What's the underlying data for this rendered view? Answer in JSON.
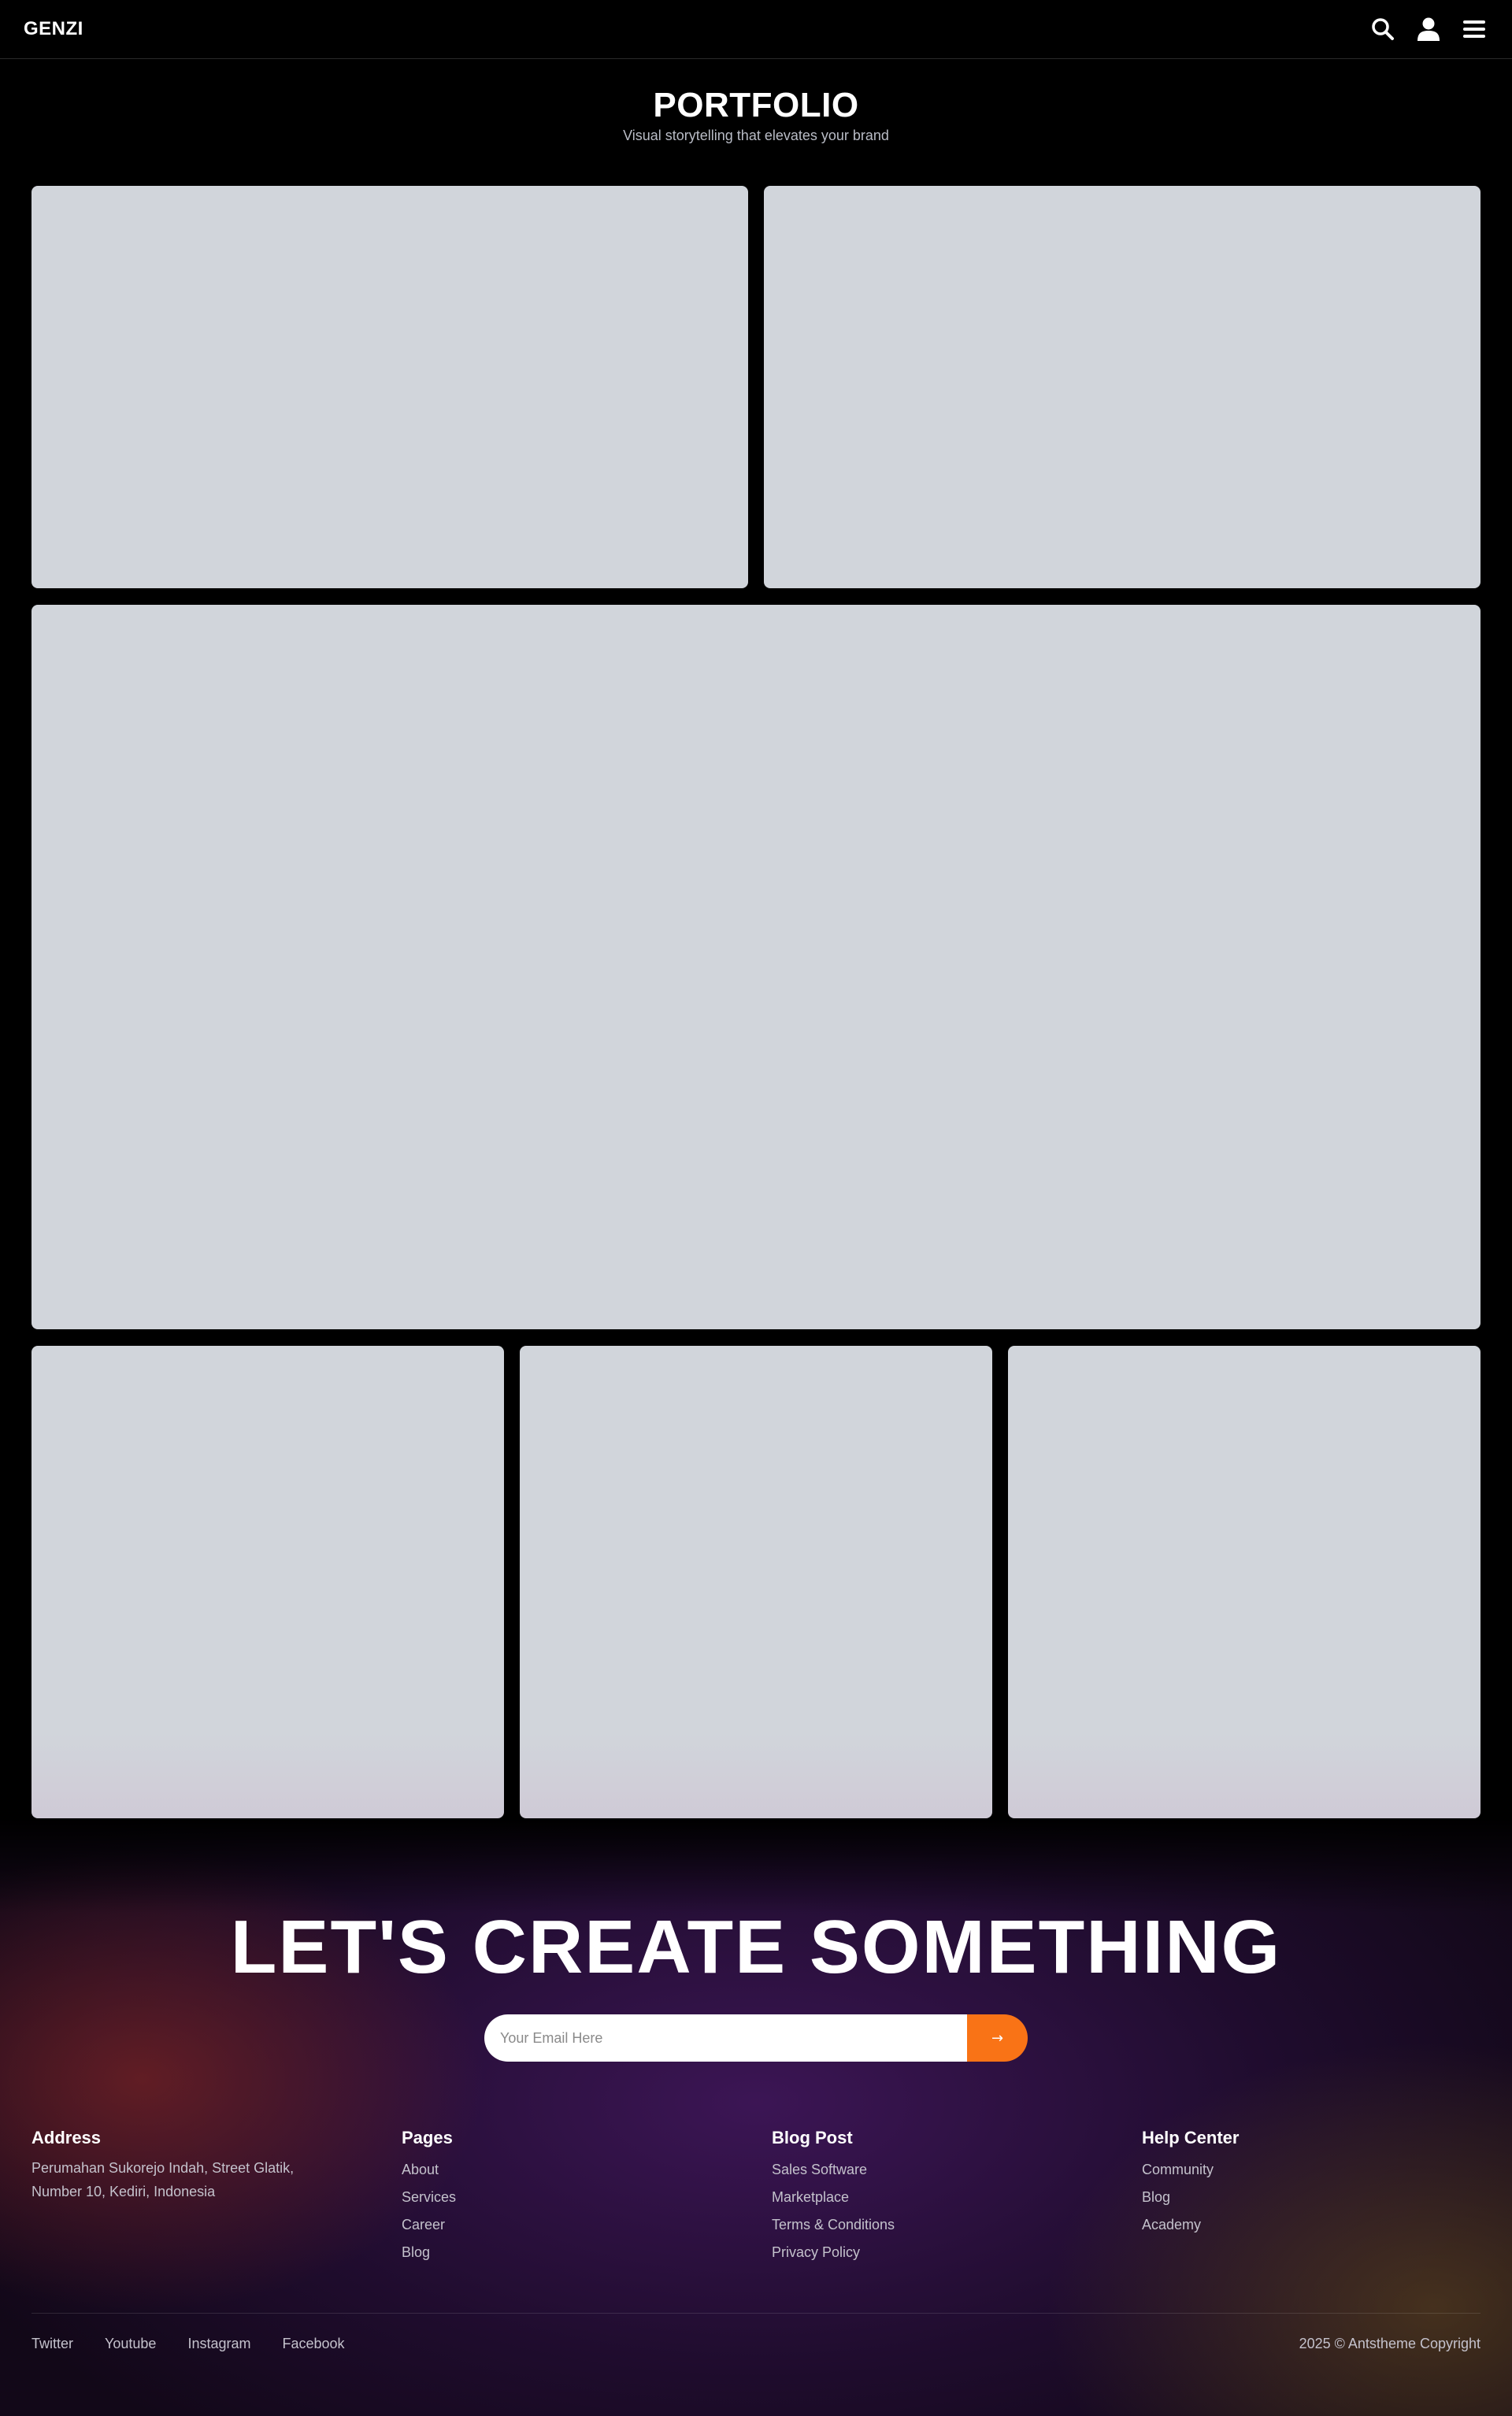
{
  "navbar": {
    "brand": "GENZI",
    "icons": [
      "search-icon",
      "user-icon",
      "menu-icon"
    ]
  },
  "portfolio": {
    "title": "PORTFOLIO",
    "subtitle": "Visual storytelling that elevates your brand"
  },
  "cta": {
    "title": "LET'S CREATE SOMETHING",
    "email_placeholder": "Your Email Here",
    "submit_label": "→",
    "accent_color": "#f97316"
  },
  "footer": {
    "address": {
      "heading": "Address",
      "text": "Perumahan Sukorejo Indah, Street Glatik, Number 10, Kediri, Indonesia"
    },
    "pages": {
      "heading": "Pages",
      "links": [
        "About",
        "Services",
        "Career",
        "Blog"
      ]
    },
    "blog_post": {
      "heading": "Blog Post",
      "links": [
        "Sales Software",
        "Marketplace",
        "Terms & Conditions",
        "Privacy Policy"
      ]
    },
    "help_center": {
      "heading": "Help Center",
      "links": [
        "Community",
        "Blog",
        "Academy"
      ]
    },
    "social": [
      "Twitter",
      "Youtube",
      "Instagram",
      "Facebook"
    ],
    "copyright": "2025 © Antstheme Copyright"
  },
  "colors": {
    "background": "#000000",
    "card_placeholder": "#d1d5db",
    "accent": "#f97316"
  }
}
